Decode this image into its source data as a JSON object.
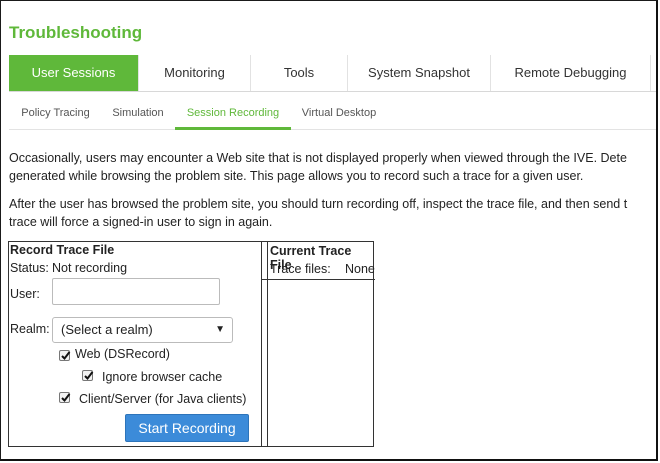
{
  "page": {
    "title": "Troubleshooting"
  },
  "tabs": [
    {
      "label": "User Sessions",
      "active": true
    },
    {
      "label": "Monitoring"
    },
    {
      "label": "Tools"
    },
    {
      "label": "System Snapshot"
    },
    {
      "label": "Remote Debugging"
    }
  ],
  "subtabs": [
    {
      "label": "Policy Tracing"
    },
    {
      "label": "Simulation"
    },
    {
      "label": "Session Recording",
      "active": true
    },
    {
      "label": "Virtual Desktop"
    }
  ],
  "intro": {
    "line1": "Occasionally, users may encounter a Web site that is not displayed properly when viewed through the IVE. Dete",
    "line2": "generated while browsing the problem site. This page allows you to record such a trace for a given user.",
    "line3": "After the user has browsed the problem site, you should turn recording off, inspect the trace file, and then send t",
    "line4": "trace will force a signed-in user to sign in again."
  },
  "record": {
    "header": "Record Trace File",
    "status_label": "Status:",
    "status_value": "Not recording",
    "user_label": "User:",
    "user_value": "",
    "realm_label": "Realm:",
    "realm_value": "(Select a realm)",
    "web_label": "Web (DSRecord)",
    "web_checked": true,
    "ignore_cache_label": "Ignore browser cache",
    "ignore_cache_checked": true,
    "client_server_label": "Client/Server (for Java clients)",
    "client_server_checked": true,
    "start_button": "Start Recording"
  },
  "current": {
    "header": "Current Trace File",
    "files_label": "Trace files:",
    "files_value": "None"
  },
  "colors": {
    "accent": "#5fb83a",
    "button": "#3c8bd9"
  }
}
